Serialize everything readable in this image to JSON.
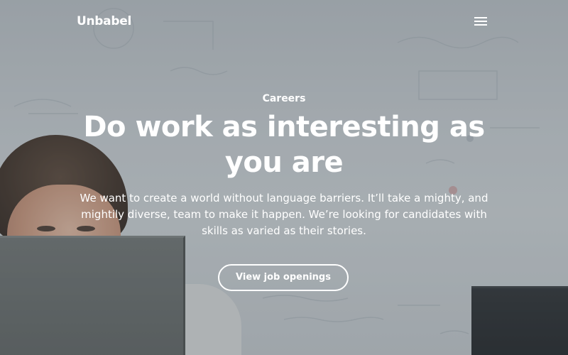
{
  "brand": {
    "logo_text": "Unbabel"
  },
  "nav": {
    "menu_icon": "hamburger-menu-icon"
  },
  "hero": {
    "eyebrow": "Careers",
    "headline": "Do work as interesting as you are",
    "subtext": "We want to create a world without language barriers. It’ll take a mighty, and mightily diverse, team to make it happen. We’re looking for candidates with skills as varied as their stories.",
    "cta_label": "View job openings"
  },
  "colors": {
    "text": "#ffffff",
    "button_border": "#ffffff"
  }
}
